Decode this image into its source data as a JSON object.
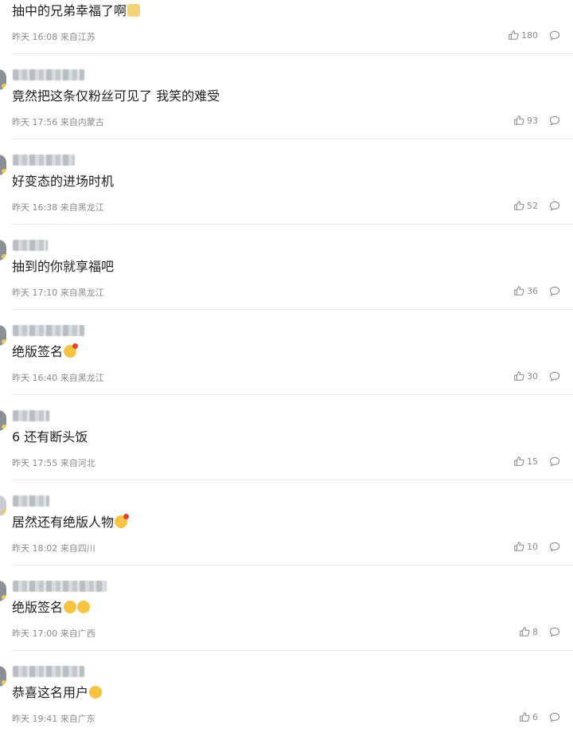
{
  "comments": [
    {
      "text": "抽中的兄弟幸福了啊",
      "emoji": "cat",
      "time": "昨天 16:08",
      "location": "来自江苏",
      "likes": "180"
    },
    {
      "text": "竟然把这条仅粉丝可见了 我笑的难受",
      "emoji": "",
      "time": "昨天 17:56",
      "location": "来自内蒙古",
      "likes": "93"
    },
    {
      "text": "好变态的进场时机",
      "emoji": "",
      "time": "昨天 16:38",
      "location": "来自黑龙江",
      "likes": "52"
    },
    {
      "text": "抽到的你就享福吧",
      "emoji": "",
      "time": "昨天 17:10",
      "location": "来自黑龙江",
      "likes": "36"
    },
    {
      "text": "绝版签名",
      "emoji": "red",
      "time": "昨天 16:40",
      "location": "来自黑龙江",
      "likes": "30"
    },
    {
      "text": "6 还有断头饭",
      "emoji": "",
      "time": "昨天 17:55",
      "location": "来自河北",
      "likes": "15"
    },
    {
      "text": "居然还有绝版人物",
      "emoji": "red",
      "time": "昨天 18:02",
      "location": "来自四川",
      "likes": "10"
    },
    {
      "text": "绝版签名",
      "emoji": "double",
      "time": "昨天 17:00",
      "location": "来自广西",
      "likes": "8"
    },
    {
      "text": "恭喜这名用户",
      "emoji": "laugh",
      "time": "昨天 19:41",
      "location": "来自广东",
      "likes": "6"
    }
  ]
}
